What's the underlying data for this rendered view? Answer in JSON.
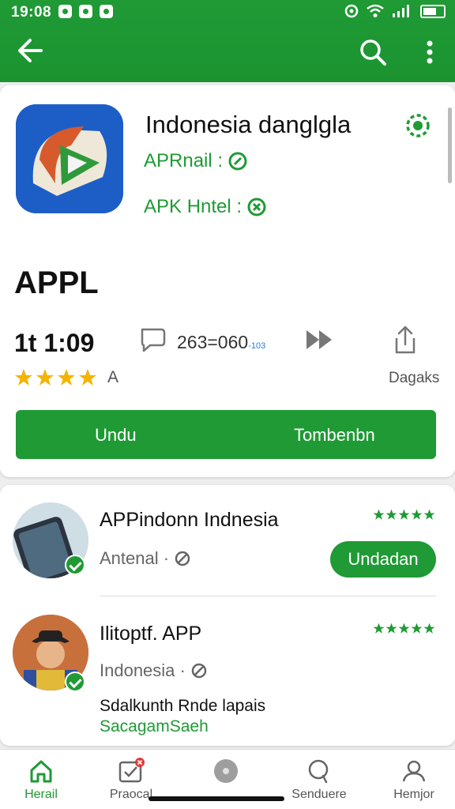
{
  "status_bar": {
    "time": "19:08"
  },
  "header": {
    "back_icon": "arrow-left-icon",
    "search_icon": "search-icon",
    "more_icon": "more-vert-icon"
  },
  "app": {
    "title": "Indonesia danglgla",
    "meta_1": "APRnail :",
    "meta_2": "APK Hntel :",
    "name": "APPL",
    "rating_text": "1t 1:09",
    "review_count": "263=060",
    "review_count_suffix": "-103",
    "stars_suffix": "A",
    "share_label": "Dagaks",
    "button_left": "Undu",
    "button_right": "Tombenbn"
  },
  "list": [
    {
      "title": "APPindonn Indnesia",
      "subtitle": "Antenal ·",
      "button": "Undadan"
    },
    {
      "title": "Ilitoptf. APP",
      "subtitle": "Indonesia ·",
      "desc_1": "Sdalkunth Rnde lapais",
      "desc_2": "SacagamSaeh"
    }
  ],
  "bottom_nav": [
    {
      "label": "Herail",
      "icon": "home-icon"
    },
    {
      "label": "Praocal",
      "icon": "checkbox-icon"
    },
    {
      "label": "",
      "icon": "circle-icon"
    },
    {
      "label": "Senduere",
      "icon": "search-icon"
    },
    {
      "label": "Hemjor",
      "icon": "profile-icon"
    }
  ],
  "colors": {
    "primary": "#1f9a35",
    "star": "#f4b400"
  }
}
